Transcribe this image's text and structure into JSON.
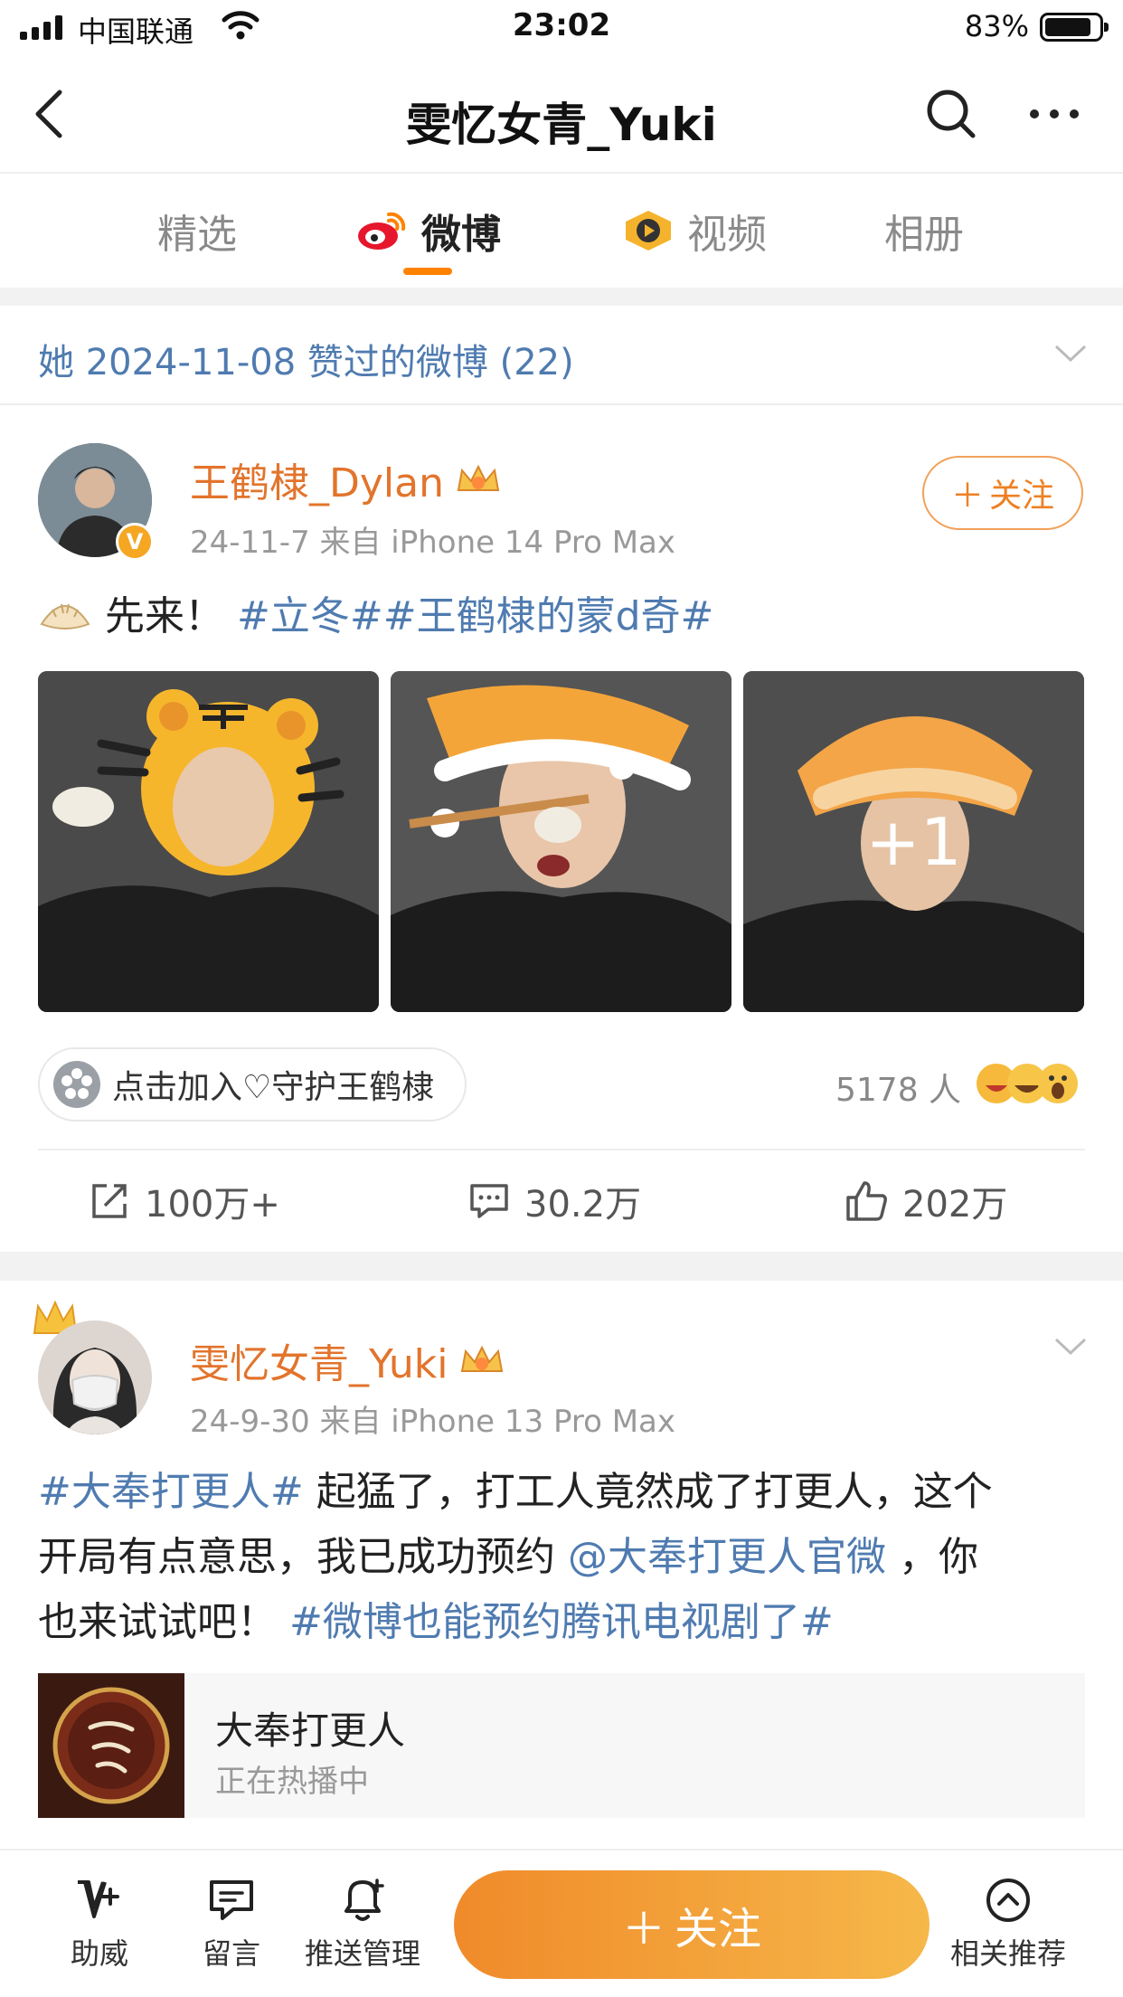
{
  "status_bar": {
    "carrier": "中国联通",
    "time": "23:02",
    "battery": "83%"
  },
  "nav": {
    "title": "雯忆女青_Yuki"
  },
  "tabs": [
    {
      "label": "精选",
      "active": false
    },
    {
      "label": "微博",
      "active": true,
      "icon": "weibo-logo-icon"
    },
    {
      "label": "视频",
      "active": false,
      "icon": "video-icon"
    },
    {
      "label": "相册",
      "active": false
    }
  ],
  "liked_header": "她 2024-11-08 赞过的微博 (22)",
  "post1": {
    "username": "王鹤棣_Dylan",
    "meta": "24-11-7  来自 iPhone 14 Pro Max",
    "follow_label": "关注",
    "text_plain": "先来！",
    "tags": "#立冬##王鹤棣的蒙d奇#",
    "photo_overflow": "+1",
    "fan_group": "点击加入♡守护王鹤棣",
    "fan_count": "5178 人",
    "reposts": "100万+",
    "comments": "30.2万",
    "likes": "202万"
  },
  "post2": {
    "username": "雯忆女青_Yuki",
    "meta": "24-9-30  来自 iPhone 13 Pro Max",
    "line1_tag": "#大奉打更人#",
    "line1_text": " 起猛了，打工人竟然成了打更人，这个",
    "line2_text": "开局有点意思，我已成功预约 ",
    "line2_mention": "@大奉打更人官微",
    "line2_tail": " ，你",
    "line3_text": "也来试试吧！ ",
    "line3_tag": "#微博也能预约腾讯电视剧了#",
    "card_title": "大奉打更人",
    "card_sub": "正在热播中"
  },
  "bottom_bar": {
    "support": "助威",
    "message": "留言",
    "push": "推送管理",
    "follow": "关注",
    "related": "相关推荐"
  },
  "colors": {
    "accent": "#ff8200",
    "link": "#4f7bb0",
    "username": "#e2742c"
  }
}
